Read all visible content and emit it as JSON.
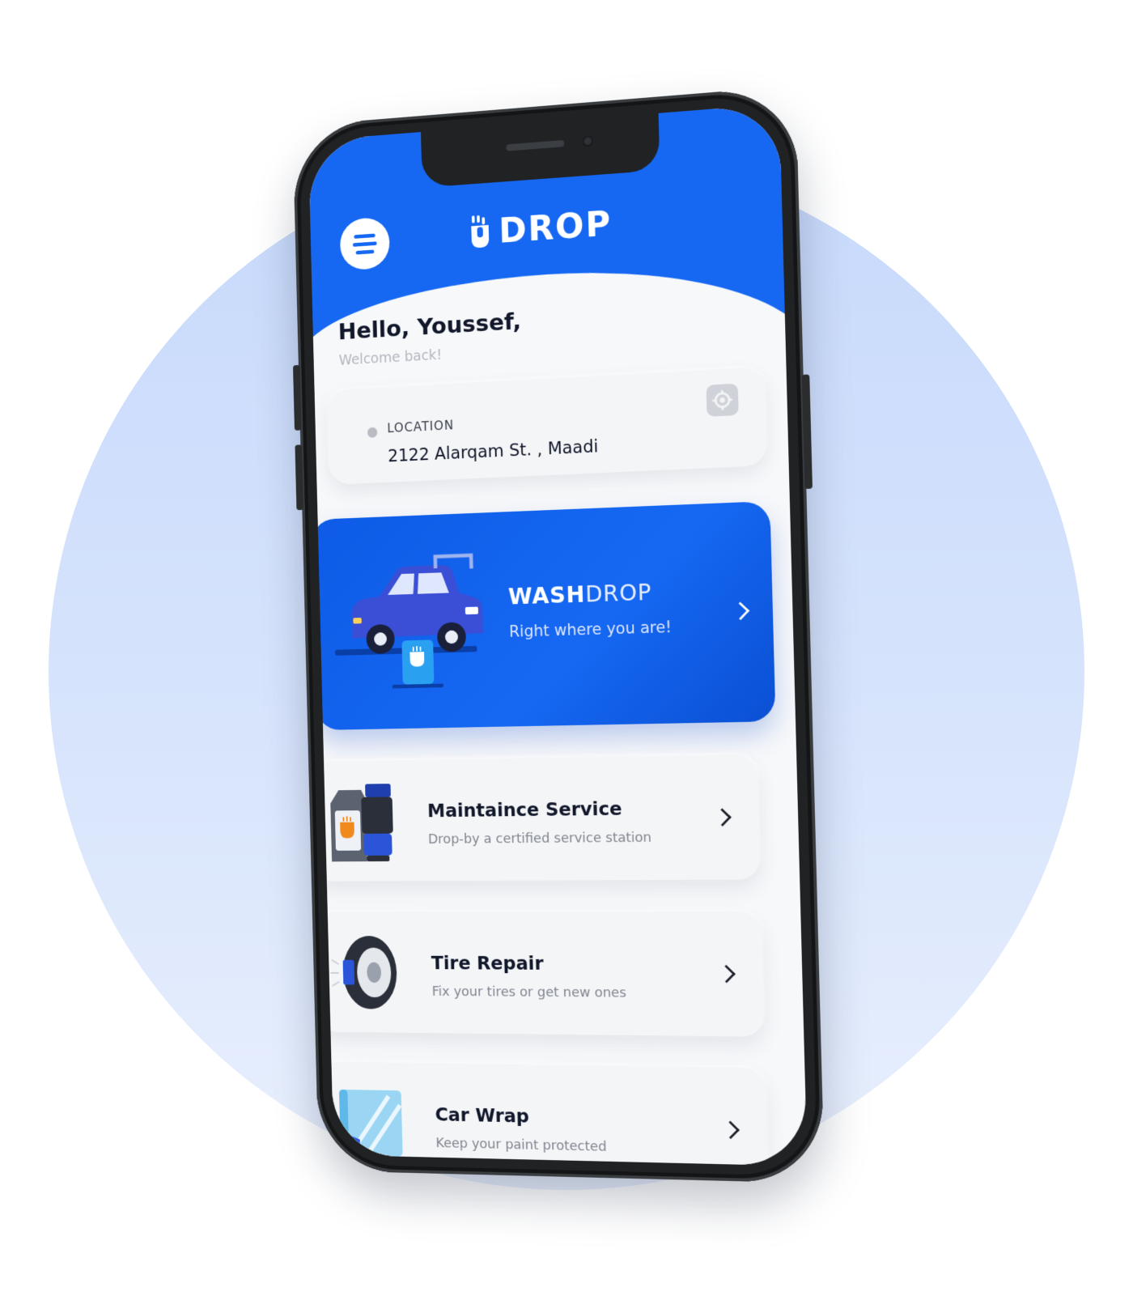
{
  "app": {
    "logo_text": "DROP",
    "brand_color": "#1668f3"
  },
  "greeting": {
    "title": "Hello, Youssef,",
    "subtitle": "Welcome back!"
  },
  "location": {
    "label": "LOCATION",
    "value": "2122 Alarqam St. , Maadi",
    "settings_icon": "gear-icon"
  },
  "promo": {
    "title_bold": "WASH",
    "title_light": "DROP",
    "subtitle": "Right where you are!",
    "icon": "car-wash-illustration"
  },
  "services": [
    {
      "title": "Maintaince Service",
      "subtitle": "Drop-by a certified service station",
      "icon": "oil-filter-icon"
    },
    {
      "title": "Tire Repair",
      "subtitle": "Fix your tires or get new ones",
      "icon": "tire-icon"
    },
    {
      "title": "Car Wrap",
      "subtitle": "Keep your paint protected",
      "icon": "wrap-shield-icon"
    }
  ]
}
